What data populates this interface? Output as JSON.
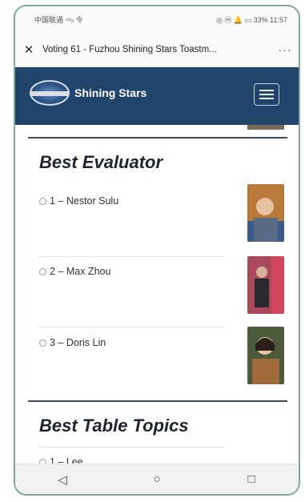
{
  "status_bar": {
    "left": "中国联通 ⁴⁶ᵢₗ 令",
    "right": "◎ ⓜ 🔔 ▭ 33% 11:57"
  },
  "browser": {
    "close_glyph": "✕",
    "title": "Voting 61 - Fuzhou Shining Stars Toastm...",
    "more_glyph": "···"
  },
  "site": {
    "name": "Shining Stars",
    "menu_icon": "hamburger-menu-icon"
  },
  "sections": [
    {
      "title": "Best Evaluator",
      "candidates": [
        {
          "label": "1 – Nestor Sulu"
        },
        {
          "label": "2 – Max Zhou"
        },
        {
          "label": "3 – Doris Lin"
        }
      ]
    },
    {
      "title": "Best Table Topics",
      "candidates": [
        {
          "label": "1 – Lee"
        }
      ]
    }
  ],
  "nav": {
    "back": "◁",
    "home": "○",
    "recent": "□"
  },
  "colors": {
    "header_bg": "#21456a",
    "frame": "#7aa8a3",
    "divider": "#3d4c63"
  }
}
